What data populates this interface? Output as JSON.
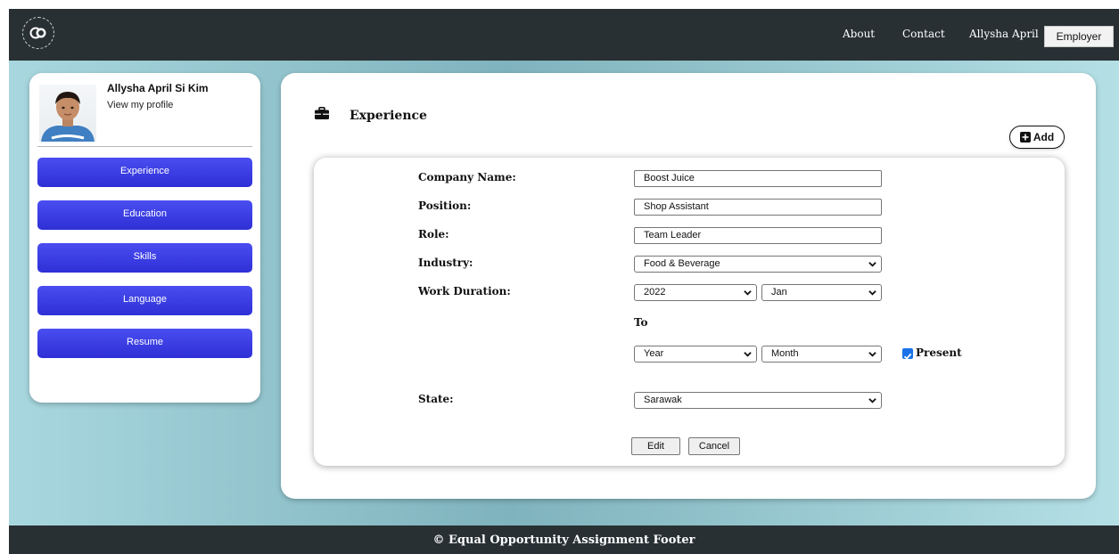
{
  "nav": {
    "links": [
      "About",
      "Contact",
      "Allysha April"
    ],
    "employer_button": "Employer",
    "logo_icon": "equal-opportunity-logo"
  },
  "sidebar": {
    "profile_name": "Allysha April Si Kim",
    "profile_link": "View my profile",
    "items": [
      {
        "label": "Experience"
      },
      {
        "label": "Education"
      },
      {
        "label": "Skills"
      },
      {
        "label": "Language"
      },
      {
        "label": "Resume"
      }
    ],
    "button_color": "#3336e0"
  },
  "main": {
    "section_title": "Experience",
    "section_icon": "briefcase-icon",
    "add_button": "Add",
    "form": {
      "company_label": "Company Name:",
      "company_value": "Boost Juice",
      "position_label": "Position:",
      "position_value": "Shop Assistant",
      "role_label": "Role:",
      "role_value": "Team Leader",
      "industry_label": "Industry:",
      "industry_value": "Food & Beverage",
      "duration_label": "Work Duration:",
      "start_year": "2022",
      "start_month": "Jan",
      "to_label": "To",
      "end_year": "Year",
      "end_month": "Month",
      "present_label": "Present",
      "present_checked": true,
      "state_label": "State:",
      "state_value": "Sarawak",
      "edit_button": "Edit",
      "cancel_button": "Cancel"
    }
  },
  "footer": {
    "text": "© Equal Opportunity Assignment Footer"
  }
}
